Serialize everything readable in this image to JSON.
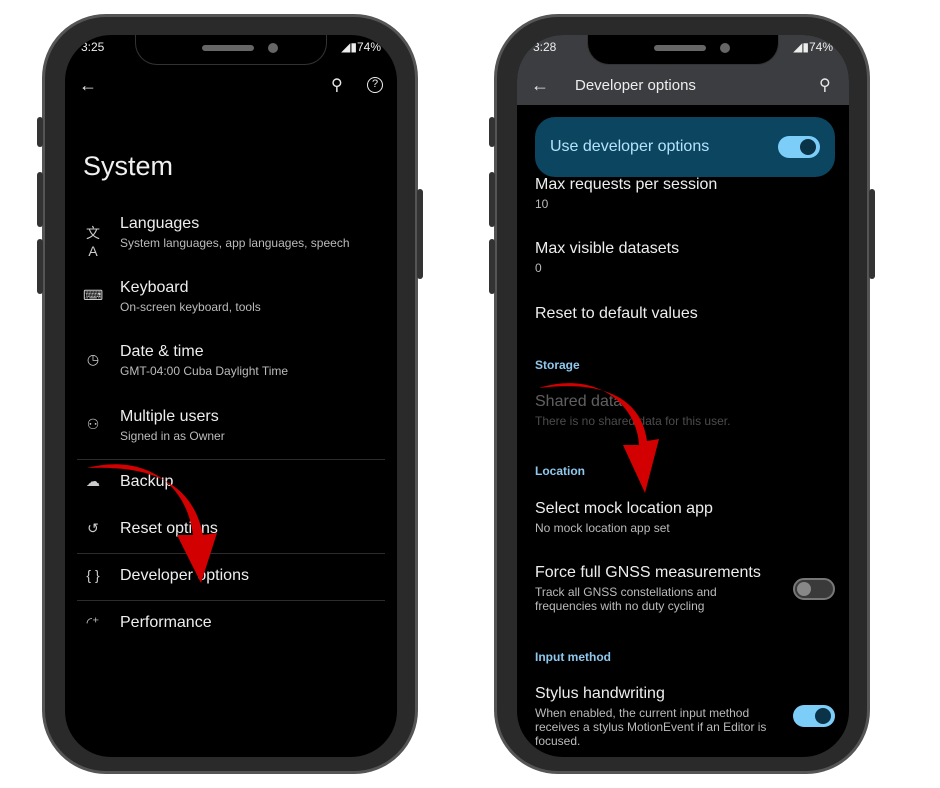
{
  "left_phone": {
    "status": {
      "time": "3:25",
      "battery": "74%"
    },
    "header": {
      "back_icon": "arrow-left",
      "search_icon": "search",
      "help_icon": "help-circle"
    },
    "title": "System",
    "items": [
      {
        "icon": "translate",
        "title": "Languages",
        "subtitle": "System languages, app languages, speech"
      },
      {
        "icon": "keyboard",
        "title": "Keyboard",
        "subtitle": "On-screen keyboard, tools"
      },
      {
        "icon": "clock",
        "title": "Date & time",
        "subtitle": "GMT-04:00 Cuba Daylight Time"
      },
      {
        "icon": "person",
        "title": "Multiple users",
        "subtitle": "Signed in as Owner"
      },
      {
        "icon": "cloud-upload",
        "title": "Backup"
      },
      {
        "icon": "history",
        "title": "Reset options"
      },
      {
        "icon": "braces",
        "title": "Developer options"
      },
      {
        "icon": "speedometer",
        "title": "Performance"
      }
    ]
  },
  "right_phone": {
    "status": {
      "time": "3:28",
      "battery": "74%"
    },
    "header": {
      "title": "Developer options"
    },
    "master_toggle": {
      "label": "Use developer options",
      "on": true
    },
    "items": [
      {
        "title": "Max requests per session",
        "subtitle": "10"
      },
      {
        "title": "Max visible datasets",
        "subtitle": "0"
      },
      {
        "title": "Reset to default values"
      }
    ],
    "storage": {
      "header": "Storage",
      "title": "Shared data",
      "subtitle": "There is no shared data for this user."
    },
    "location": {
      "header": "Location",
      "mock": {
        "title": "Select mock location app",
        "subtitle": "No mock location app set"
      },
      "gnss": {
        "title": "Force full GNSS measurements",
        "subtitle1": "Track all GNSS constellations and",
        "subtitle2": "frequencies with no duty cycling",
        "on": false
      }
    },
    "input": {
      "header": "Input method",
      "title": "Stylus handwriting",
      "subtitle1": "When enabled, the current input method",
      "subtitle2": "receives a stylus MotionEvent if an Editor is",
      "subtitle3": "focused.",
      "on": true
    }
  },
  "colors": {
    "accent_toggle": "#7ccdf8",
    "banner": "#0b4560",
    "arrow": "#d20000",
    "section": "#8fc8ee"
  }
}
